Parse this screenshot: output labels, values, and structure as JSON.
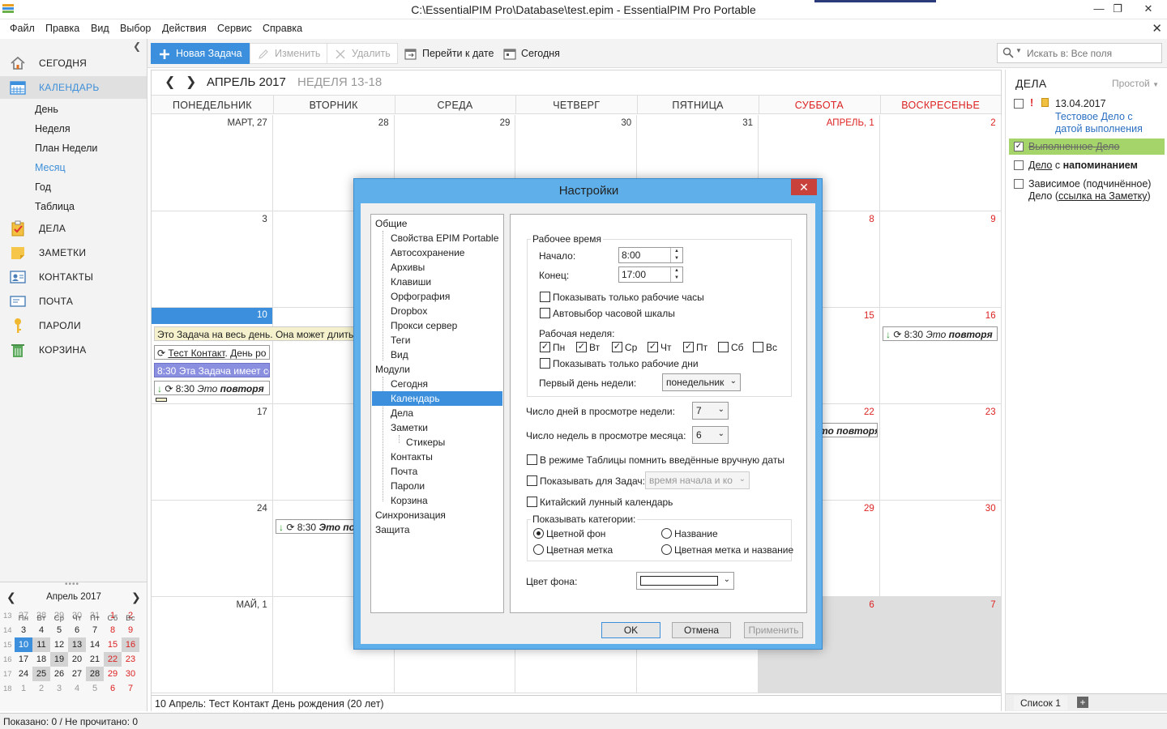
{
  "window": {
    "title": "C:\\EssentialPIM Pro\\Database\\test.epim - EssentialPIM Pro Portable"
  },
  "menu": [
    "Файл",
    "Правка",
    "Вид",
    "Выбор",
    "Действия",
    "Сервис",
    "Справка"
  ],
  "nav": {
    "today": "СЕГОДНЯ",
    "calendar": "КАЛЕНДАРЬ",
    "sub": [
      "День",
      "Неделя",
      "План Недели",
      "Месяц",
      "Год",
      "Таблица"
    ],
    "tasks": "ДЕЛА",
    "notes": "ЗАМЕТКИ",
    "contacts": "КОНТАКТЫ",
    "mail": "ПОЧТА",
    "passwords": "ПАРОЛИ",
    "trash": "КОРЗИНА"
  },
  "minical": {
    "title": "Апрель  2017",
    "dow": [
      "Пн",
      "Вт",
      "Ср",
      "Чт",
      "Пт",
      "Сб",
      "Вс"
    ],
    "weeks": [
      {
        "wk": "13",
        "days": [
          "27",
          "28",
          "29",
          "30",
          "31",
          "1",
          "2"
        ]
      },
      {
        "wk": "14",
        "days": [
          "3",
          "4",
          "5",
          "6",
          "7",
          "8",
          "9"
        ]
      },
      {
        "wk": "15",
        "days": [
          "10",
          "11",
          "12",
          "13",
          "14",
          "15",
          "16"
        ]
      },
      {
        "wk": "16",
        "days": [
          "17",
          "18",
          "19",
          "20",
          "21",
          "22",
          "23"
        ]
      },
      {
        "wk": "17",
        "days": [
          "24",
          "25",
          "26",
          "27",
          "28",
          "29",
          "30"
        ]
      },
      {
        "wk": "18",
        "days": [
          "1",
          "2",
          "3",
          "4",
          "5",
          "6",
          "7"
        ]
      }
    ]
  },
  "toolbar": {
    "new_task": "Новая Задача",
    "edit": "Изменить",
    "delete": "Удалить",
    "goto_date": "Перейти к дате",
    "today": "Сегодня",
    "search_placeholder": "Искать в: Все поля"
  },
  "calendar": {
    "month": "АПРЕЛЬ 2017",
    "week": "НЕДЕЛЯ 13-18",
    "dow": [
      "ПОНЕДЕЛЬНИК",
      "ВТОРНИК",
      "СРЕДА",
      "ЧЕТВЕРГ",
      "ПЯТНИЦА",
      "СУББОТА",
      "ВОСКРЕСЕНЬЕ"
    ],
    "rows": [
      [
        "МАРТ, 27",
        "28",
        "29",
        "30",
        "31",
        "АПРЕЛЬ, 1",
        "2"
      ],
      [
        "3",
        "4",
        "5",
        "6",
        "7",
        "8",
        "9"
      ],
      [
        "10",
        "11",
        "12",
        "13",
        "14",
        "15",
        "16"
      ],
      [
        "17",
        "18",
        "19",
        "20",
        "21",
        "22",
        "23"
      ],
      [
        "24",
        "25",
        "26",
        "27",
        "28",
        "29",
        "30"
      ],
      [
        "МАЙ, 1",
        "2",
        "3",
        "4",
        "5",
        "6",
        "7"
      ]
    ],
    "events": {
      "allday": "Это Задача на весь день. Она может длиться",
      "contact_link": "Тест Контакт",
      "contact_rest": ". День ро",
      "task_link": "8:30 Эта Задача имеет ссы",
      "repeat_time": "8:30",
      "repeat_prefix": "Это",
      "repeat_bold": "повторя",
      "repeat_short": "Это по",
      "repeat_sat": "то повторя"
    },
    "status": "10 Апрель:  Тест Контакт День рождения  (20 лет)"
  },
  "tasks": {
    "title": "ДЕЛА",
    "view": "Простой",
    "items": {
      "t1_date": "13.04.2017",
      "t1_text": "Тестовое Дело с датой выполнения",
      "t2": "Выполненное Дело",
      "t3_a": "Дело",
      "t3_b": " с ",
      "t3_c": "напоминанием",
      "t4_a": "Зависимое (подчинённое)",
      "t4_b": "Дело (",
      "t4_c": "ссылка на Заметку",
      "t4_d": ")"
    },
    "footer_tab": "Список 1"
  },
  "statusbar": "Показано: 0 / Не прочитано: 0",
  "dialog": {
    "title": "Настройки",
    "tree": {
      "general": "Общие",
      "props": "Свойства EPIM Portable",
      "autosave": "Автосохранение",
      "archives": "Архивы",
      "keys": "Клавиши",
      "spell": "Орфография",
      "dropbox": "Dropbox",
      "proxy": "Прокси сервер",
      "tags": "Теги",
      "view": "Вид",
      "modules": "Модули",
      "today": "Сегодня",
      "calendar": "Календарь",
      "tasks": "Дела",
      "notes": "Заметки",
      "stickers": "Стикеры",
      "contacts": "Контакты",
      "mail": "Почта",
      "passwords": "Пароли",
      "trash": "Корзина",
      "sync": "Синхронизация",
      "security": "Защита"
    },
    "panel": {
      "work_time": "Рабочее время",
      "start_label": "Начало:",
      "start_value": "8:00",
      "end_label": "Конец:",
      "end_value": "17:00",
      "only_work_hours": "Показывать только рабочие часы",
      "auto_scale": "Автовыбор часовой шкалы",
      "work_week": "Рабочая неделя:",
      "days": [
        "Пн",
        "Вт",
        "Ср",
        "Чт",
        "Пт",
        "Сб",
        "Вс"
      ],
      "only_work_days": "Показывать только рабочие дни",
      "first_day_label": "Первый день недели:",
      "first_day_value": "понедельник",
      "days_in_week_label": "Число дней в просмотре недели:",
      "days_in_week_value": "7",
      "weeks_in_month_label": "Число недель в просмотре месяца:",
      "weeks_in_month_value": "6",
      "remember_dates": "В режиме Таблицы помнить введённые вручную даты",
      "show_for_tasks": "Показывать для Задач:",
      "show_for_tasks_value": "время начала и ко",
      "lunar": "Китайский лунный календарь",
      "show_categories": "Показывать категории:",
      "cat_bg": "Цветной фон",
      "cat_name": "Название",
      "cat_mark": "Цветная метка",
      "cat_mark_name": "Цветная метка и название",
      "bg_color": "Цвет фона:"
    },
    "buttons": {
      "ok": "OK",
      "cancel": "Отмена",
      "apply": "Применить"
    }
  },
  "colors": {
    "accent": "#3b8fdc",
    "red": "#dd2222",
    "done_green": "#a5d46a"
  }
}
